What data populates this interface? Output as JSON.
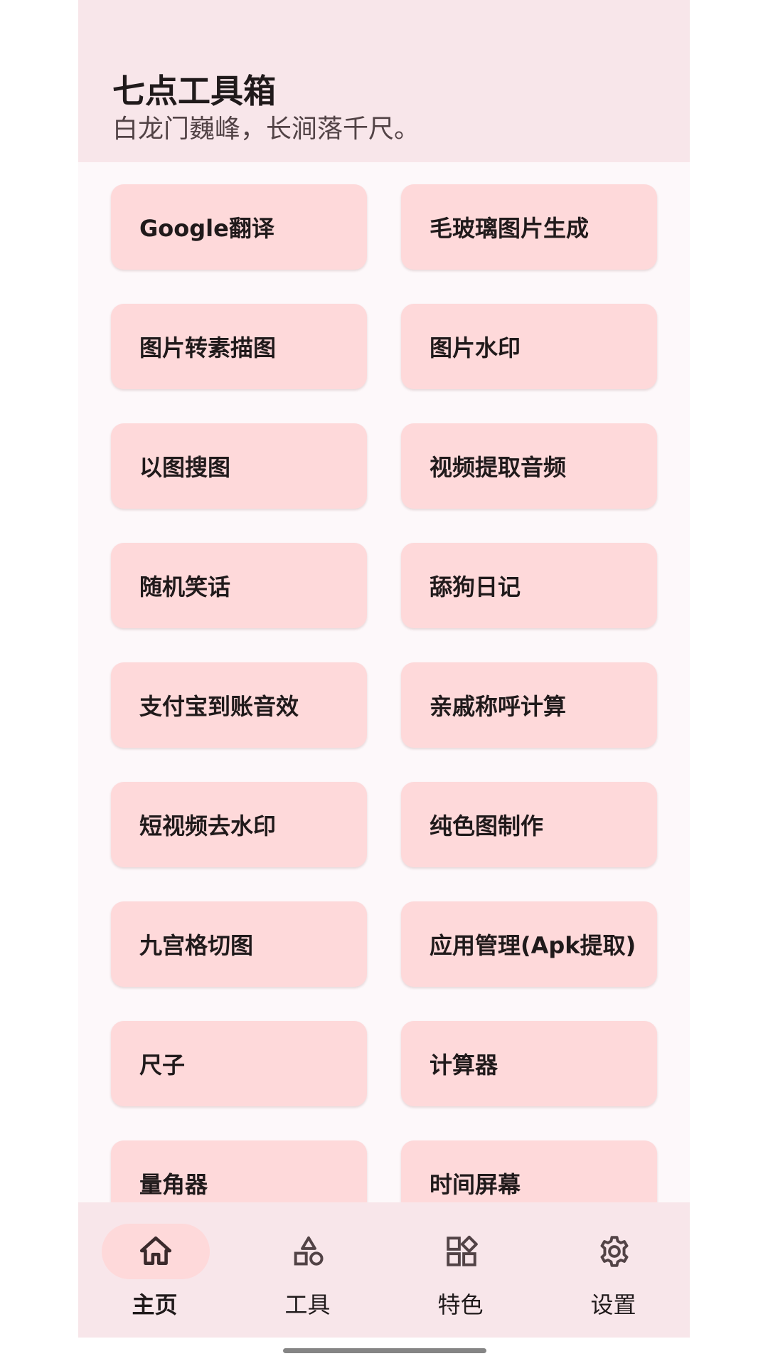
{
  "header": {
    "title": "七点工具箱",
    "subtitle": "白龙门巍峰，长涧落千尺。"
  },
  "tools": [
    "Google翻译",
    "毛玻璃图片生成",
    "图片转素描图",
    "图片水印",
    "以图搜图",
    "视频提取音频",
    "随机笑话",
    "舔狗日记",
    "支付宝到账音效",
    "亲戚称呼计算",
    "短视频去水印",
    "纯色图制作",
    "九宫格切图",
    "应用管理(Apk提取)",
    "尺子",
    "计算器",
    "量角器",
    "时间屏幕"
  ],
  "bottom_nav": {
    "active": "home",
    "items": [
      {
        "label": "主页",
        "icon": "home-icon"
      },
      {
        "label": "工具",
        "icon": "shapes-icon"
      },
      {
        "label": "特色",
        "icon": "widgets-icon"
      },
      {
        "label": "设置",
        "icon": "gear-icon"
      }
    ]
  },
  "colors": {
    "header_bg": "#f8e6ea",
    "page_bg": "#fdf8fa",
    "card_bg": "#fed9da",
    "text": "#201a1b"
  }
}
